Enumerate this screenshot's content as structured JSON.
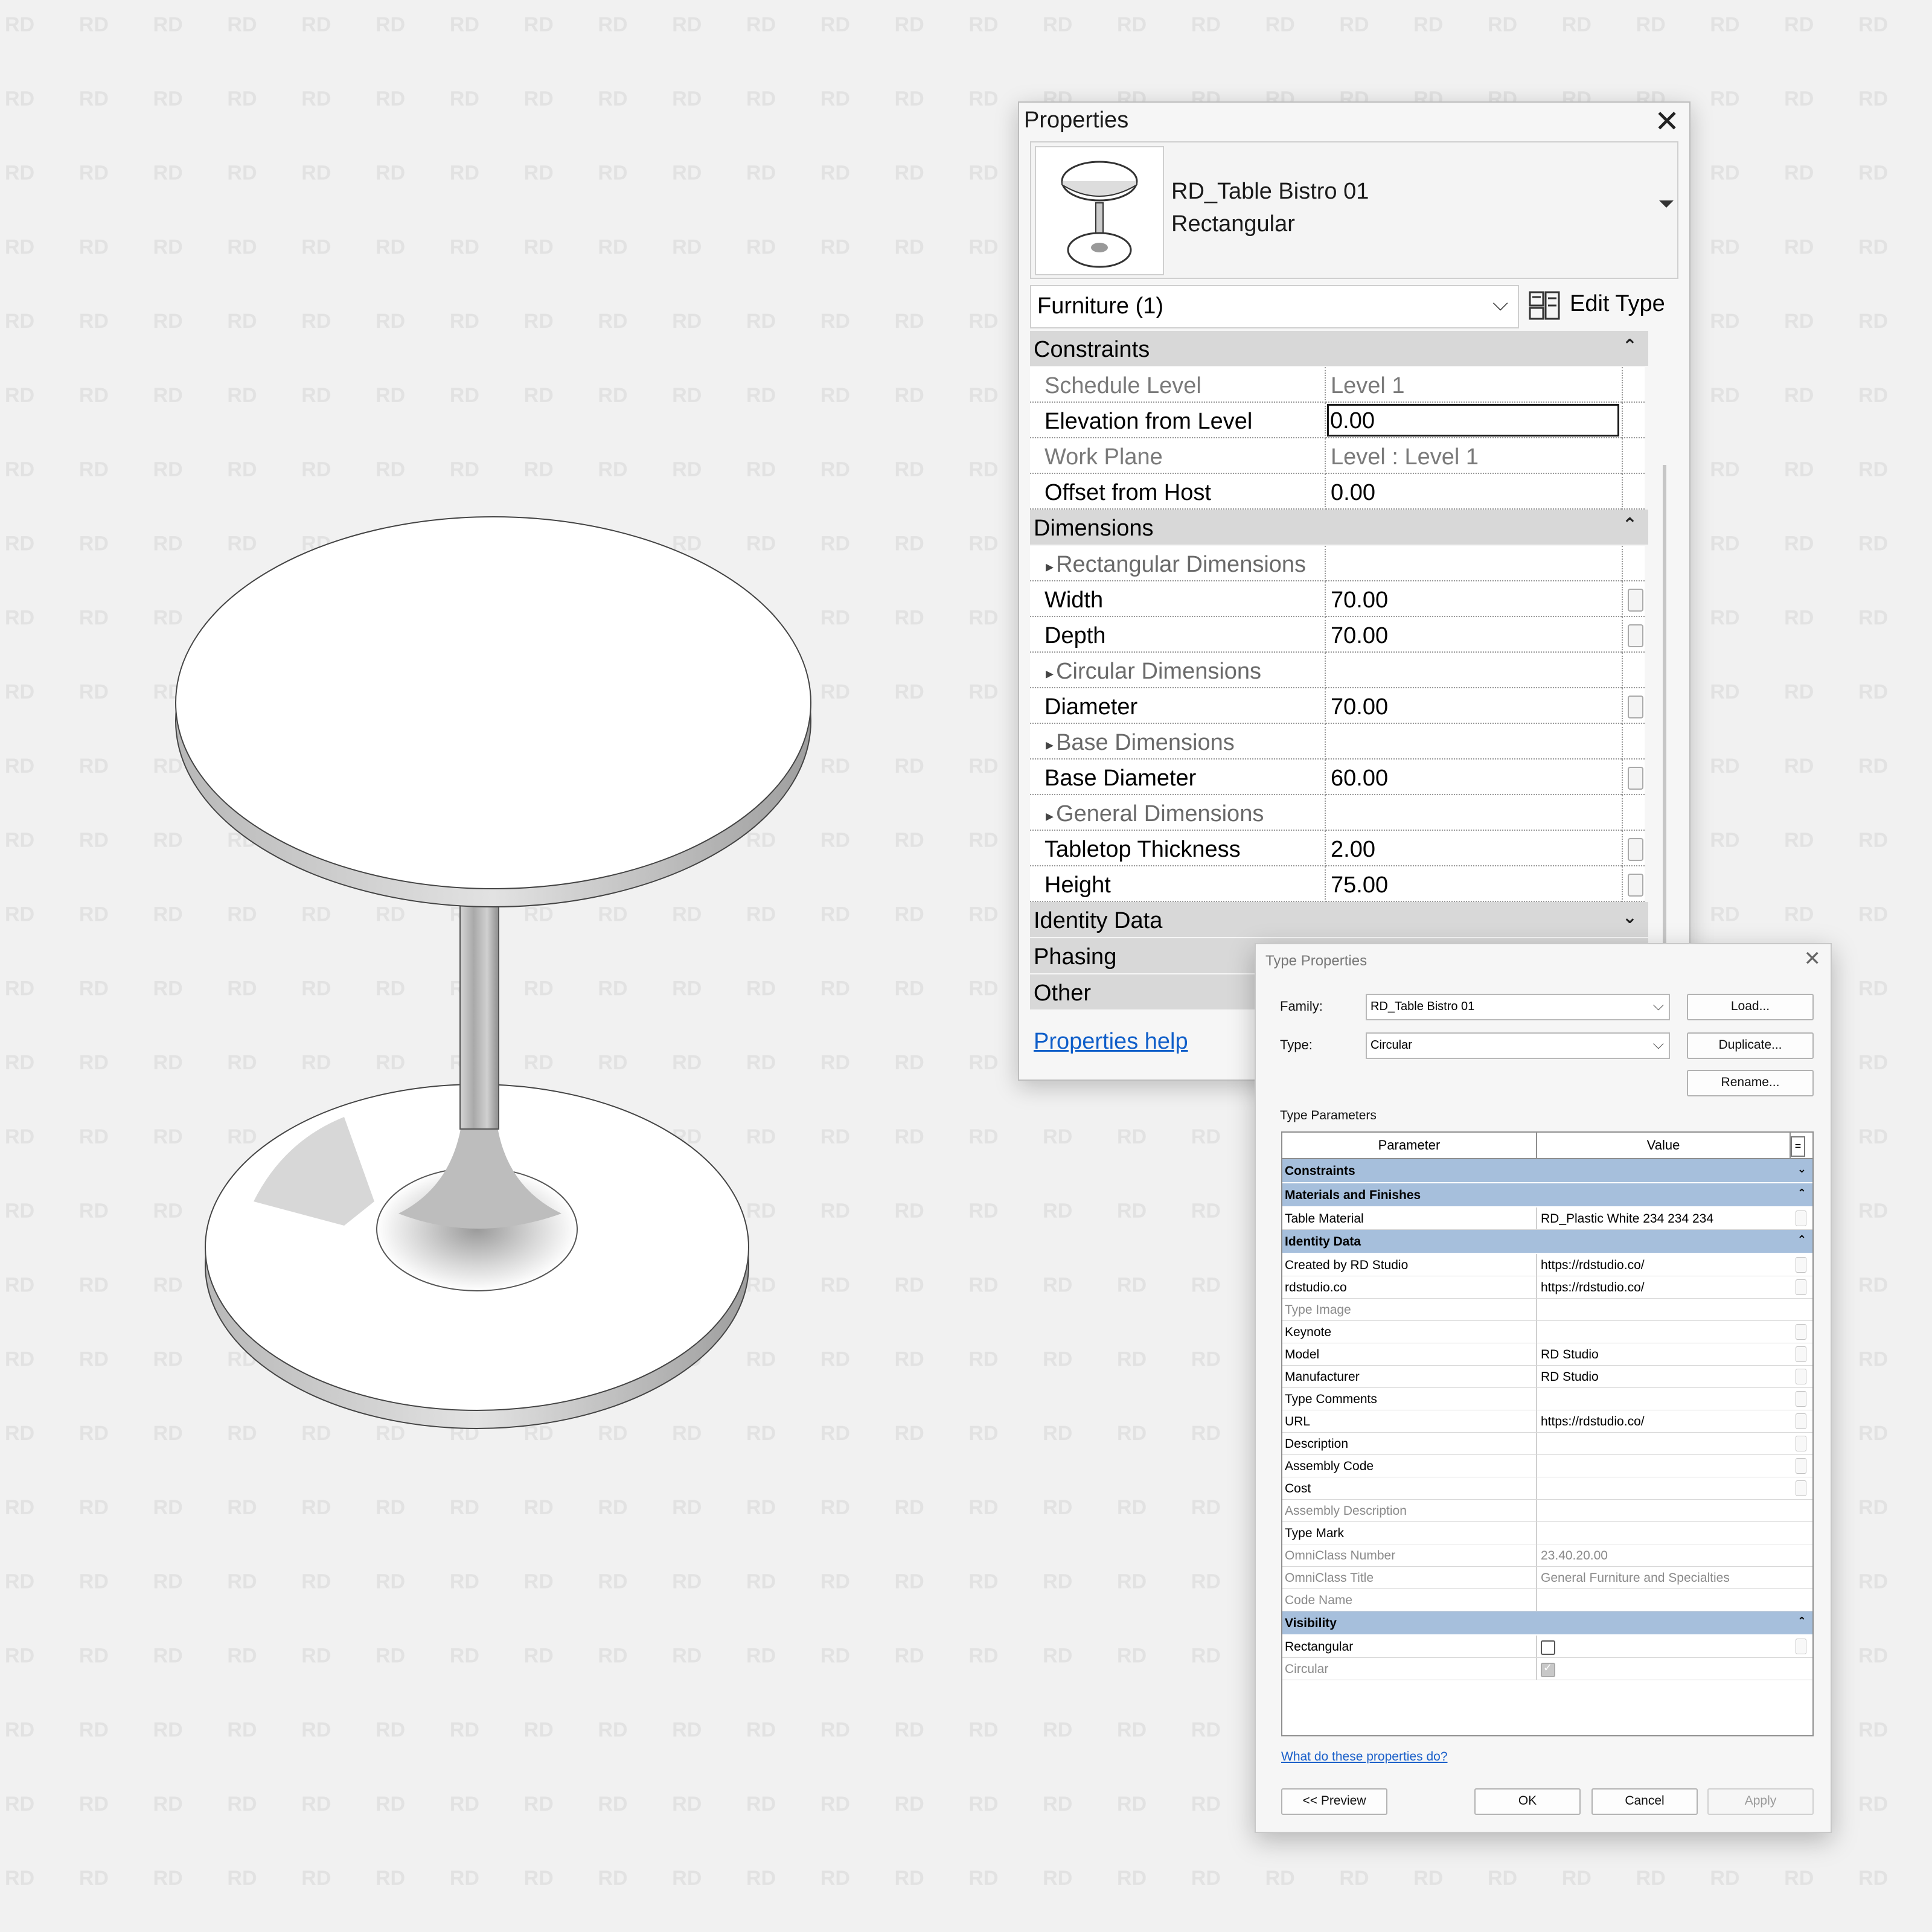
{
  "watermark": "RD",
  "properties": {
    "title": "Properties",
    "family_name": "RD_Table Bistro 01",
    "type_name": "Rectangular",
    "filter": "Furniture (1)",
    "edit_type_label": "Edit Type",
    "groups": [
      {
        "name": "Constraints",
        "expanded": true,
        "rows": [
          {
            "name": "Schedule Level",
            "value": "Level 1",
            "readonly": true
          },
          {
            "name": "Elevation from Level",
            "value": "0.00",
            "editing": true
          },
          {
            "name": "Work Plane",
            "value": "Level : Level 1",
            "readonly": true
          },
          {
            "name": "Offset from Host",
            "value": "0.00"
          }
        ]
      },
      {
        "name": "Dimensions",
        "expanded": true,
        "rows": [
          {
            "name": "Rectangular Dimensions",
            "value": "",
            "subheader": true
          },
          {
            "name": "Width",
            "value": "70.00",
            "fx": true
          },
          {
            "name": "Depth",
            "value": "70.00",
            "fx": true
          },
          {
            "name": "Circular Dimensions",
            "value": "",
            "subheader": true
          },
          {
            "name": "Diameter",
            "value": "70.00",
            "fx": true
          },
          {
            "name": "Base Dimensions",
            "value": "",
            "subheader": true
          },
          {
            "name": "Base Diameter",
            "value": "60.00",
            "fx": true
          },
          {
            "name": "General Dimensions",
            "value": "",
            "subheader": true
          },
          {
            "name": "Tabletop Thickness",
            "value": "2.00",
            "fx": true
          },
          {
            "name": "Height",
            "value": "75.00",
            "fx": true
          }
        ]
      },
      {
        "name": "Identity Data",
        "expanded": false,
        "rows": []
      },
      {
        "name": "Phasing",
        "expanded": false,
        "rows": []
      },
      {
        "name": "Other",
        "expanded": false,
        "rows": []
      }
    ],
    "help_link": "Properties help"
  },
  "type_properties": {
    "title": "Type Properties",
    "family_label": "Family:",
    "family_value": "RD_Table Bistro 01",
    "type_label": "Type:",
    "type_value": "Circular",
    "load_button": "Load...",
    "duplicate_button": "Duplicate...",
    "rename_button": "Rename...",
    "section_label": "Type Parameters",
    "col_parameter": "Parameter",
    "col_value": "Value",
    "col_equals": "=",
    "groups": [
      {
        "name": "Constraints",
        "expanded": false,
        "rows": []
      },
      {
        "name": "Materials and Finishes",
        "expanded": true,
        "rows": [
          {
            "name": "Table Material",
            "value": "RD_Plastic White 234 234 234",
            "fx": true
          }
        ]
      },
      {
        "name": "Identity Data",
        "expanded": true,
        "rows": [
          {
            "name": "Created by RD Studio",
            "value": "https://rdstudio.co/",
            "fx": true
          },
          {
            "name": "rdstudio.co",
            "value": "https://rdstudio.co/",
            "fx": true
          },
          {
            "name": "Type Image",
            "value": "",
            "readonly": true
          },
          {
            "name": "Keynote",
            "value": "",
            "fx": true
          },
          {
            "name": "Model",
            "value": "RD Studio",
            "fx": true
          },
          {
            "name": "Manufacturer",
            "value": "RD Studio",
            "fx": true
          },
          {
            "name": "Type Comments",
            "value": "",
            "fx": true
          },
          {
            "name": "URL",
            "value": "https://rdstudio.co/",
            "fx": true
          },
          {
            "name": "Description",
            "value": "",
            "fx": true
          },
          {
            "name": "Assembly Code",
            "value": "",
            "fx": true
          },
          {
            "name": "Cost",
            "value": "",
            "fx": true
          },
          {
            "name": "Assembly Description",
            "value": "",
            "readonly": true
          },
          {
            "name": "Type Mark",
            "value": ""
          },
          {
            "name": "OmniClass Number",
            "value": "23.40.20.00",
            "readonly": true
          },
          {
            "name": "OmniClass Title",
            "value": "General Furniture and Specialties",
            "readonly": true
          },
          {
            "name": "Code Name",
            "value": "",
            "readonly": true
          }
        ]
      },
      {
        "name": "Visibility",
        "expanded": true,
        "rows": [
          {
            "name": "Rectangular",
            "checkbox": true,
            "checked": false,
            "fx": true
          },
          {
            "name": "Circular",
            "checkbox": true,
            "checked": true,
            "readonly": true
          }
        ]
      }
    ],
    "help_link": "What do these properties do?",
    "preview_button": "<< Preview",
    "ok_button": "OK",
    "cancel_button": "Cancel",
    "apply_button": "Apply"
  }
}
